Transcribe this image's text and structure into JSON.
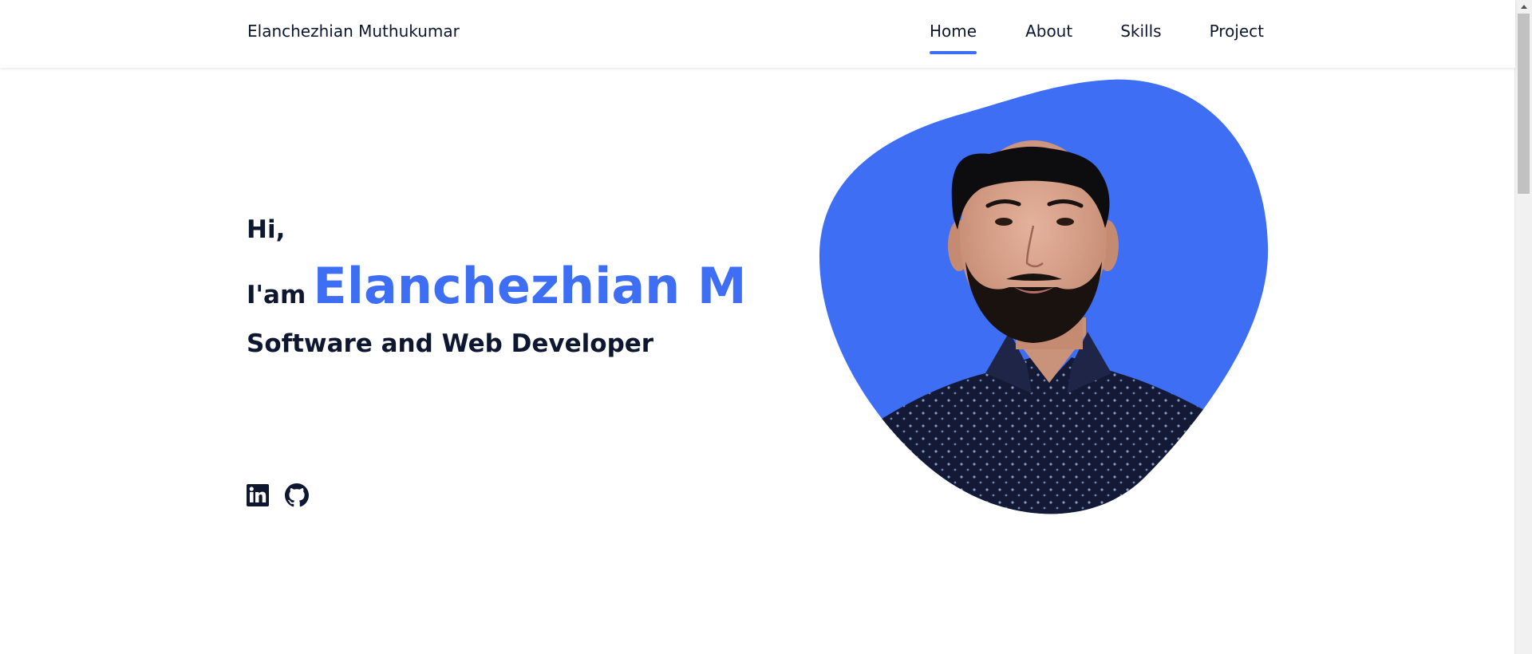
{
  "header": {
    "logo": "Elanchezhian Muthukumar",
    "nav": [
      {
        "label": "Home",
        "active": true
      },
      {
        "label": "About",
        "active": false
      },
      {
        "label": "Skills",
        "active": false
      },
      {
        "label": "Project",
        "active": false
      }
    ]
  },
  "hero": {
    "greeting": "Hi,",
    "iam": "I'am",
    "name": "Elanchezhian M",
    "role": "Software and Web Developer"
  },
  "social": [
    {
      "icon": "linkedin-icon"
    },
    {
      "icon": "github-icon"
    }
  ],
  "colors": {
    "accent": "#3d6ef4",
    "text": "#0e1730"
  }
}
